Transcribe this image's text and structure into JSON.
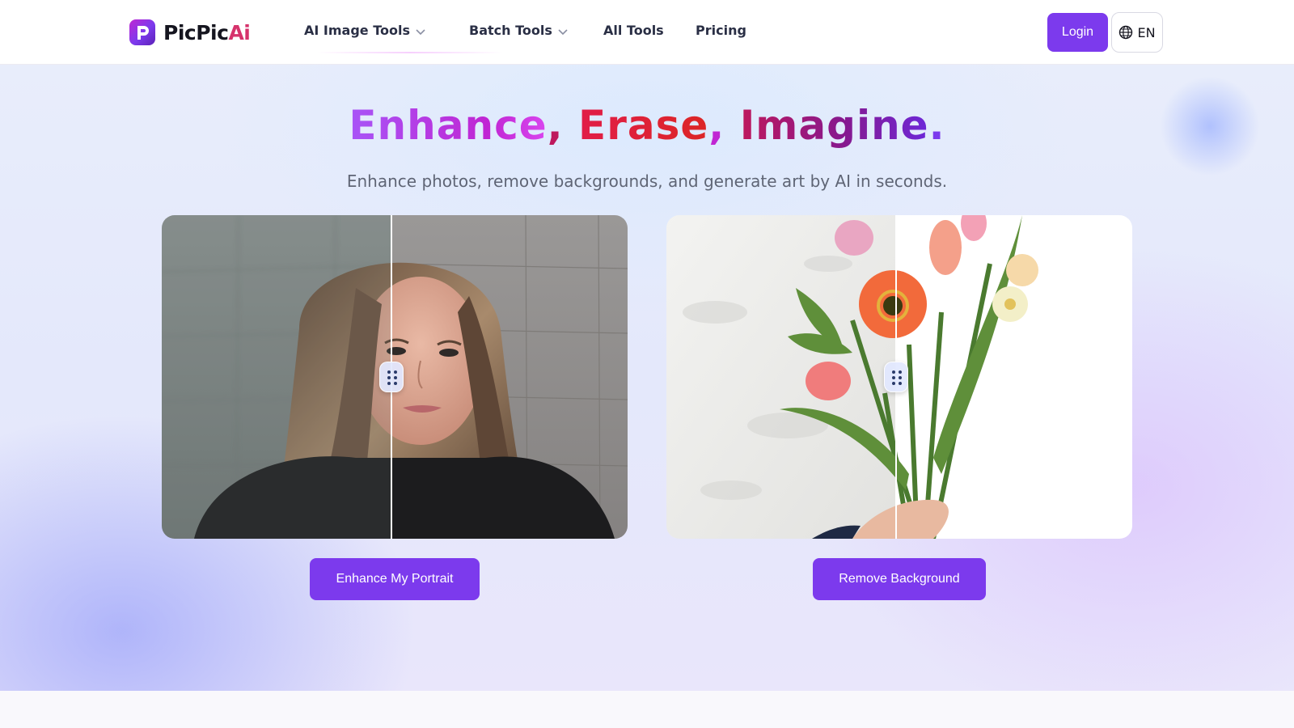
{
  "header": {
    "logo": {
      "part1": "PicPic",
      "part2": "Ai"
    },
    "nav": [
      {
        "label": "AI Image Tools",
        "has_dropdown": true
      },
      {
        "label": "Batch Tools",
        "has_dropdown": true
      },
      {
        "label": "All Tools",
        "has_dropdown": false
      },
      {
        "label": "Pricing",
        "has_dropdown": false
      }
    ],
    "login_label": "Login",
    "language": "EN"
  },
  "hero": {
    "title": {
      "word1": "Enhance",
      "word2": "Erase",
      "word3": "Imagine",
      "sep": ",",
      "end": "."
    },
    "subtitle": "Enhance photos, remove backgrounds, and generate art by AI in seconds.",
    "cards": [
      {
        "cta_label": "Enhance My Portrait"
      },
      {
        "cta_label": "Remove Background"
      }
    ]
  },
  "colors": {
    "accent": "#7c3aed",
    "logo_ai": "#d6336c"
  },
  "icons": [
    "logo-icon",
    "chevron-down-icon",
    "globe-icon",
    "drag-handle-icon"
  ]
}
